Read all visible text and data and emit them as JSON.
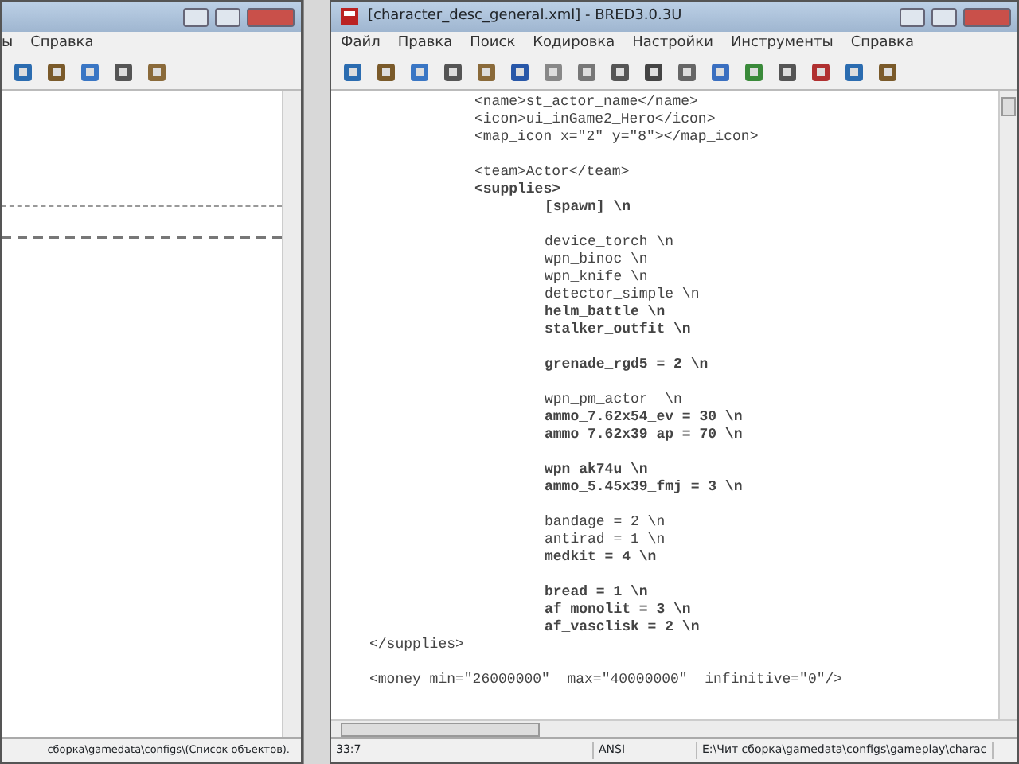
{
  "left_window": {
    "menu": [
      "ы",
      "Справка"
    ],
    "status_bar": "сборка\\gamedata\\configs\\(Список объектов)."
  },
  "editor_window": {
    "title": "[character_desc_general.xml] - BRED3.0.3U",
    "menu": [
      "Файл",
      "Правка",
      "Поиск",
      "Кодировка",
      "Настройки",
      "Инструменты",
      "Справка"
    ],
    "code": [
      {
        "children": [
          {
            "text": "<name>st_actor_name</name>",
            "bold": false
          },
          {
            "text": "<icon>ui_inGame2_Hero</icon>",
            "bold": false
          },
          {
            "text": "<map_icon x=\"2\" y=\"8\"></map_icon>",
            "bold": false
          },
          {
            "kind": "blank"
          },
          {
            "text": "<team>Actor</team>",
            "bold": false
          },
          {
            "text": "<supplies>",
            "bold": true,
            "children": [
              {
                "text": "[spawn] \\n",
                "bold": true
              },
              {
                "kind": "blank"
              },
              {
                "text": "device_torch \\n",
                "bold": false
              },
              {
                "text": "wpn_binoc \\n",
                "bold": false
              },
              {
                "text": "wpn_knife \\n",
                "bold": false
              },
              {
                "text": "detector_simple \\n",
                "bold": false
              },
              {
                "text": "helm_battle \\n",
                "bold": true
              },
              {
                "text": "stalker_outfit \\n",
                "bold": true
              },
              {
                "kind": "blank"
              },
              {
                "text": "grenade_rgd5 = 2 \\n",
                "bold": true
              },
              {
                "kind": "blank"
              },
              {
                "text": "wpn_pm_actor  \\n",
                "bold": false
              },
              {
                "text": "ammo_7.62x54_ev = 30 \\n",
                "bold": true
              },
              {
                "text": "ammo_7.62x39_ap = 70 \\n",
                "bold": true
              },
              {
                "kind": "blank"
              },
              {
                "text": "wpn_ak74u \\n",
                "bold": true
              },
              {
                "text": "ammo_5.45x39_fmj = 3 \\n",
                "bold": true
              },
              {
                "kind": "blank"
              },
              {
                "text": "bandage = 2 \\n",
                "bold": false
              },
              {
                "text": "antirad = 1 \\n",
                "bold": false
              },
              {
                "text": "medkit = 4 \\n",
                "bold": true
              },
              {
                "kind": "blank"
              },
              {
                "text": "bread = 1 \\n",
                "bold": true
              },
              {
                "text": "af_monolit = 3 \\n",
                "bold": true
              },
              {
                "text": "af_vasclisk = 2 \\n",
                "bold": true
              }
            ]
          }
        ]
      },
      {
        "text": "</supplies>",
        "bold": false
      },
      {
        "kind": "blank"
      },
      {
        "text": "<money min=\"26000000\"  max=\"40000000\"  infinitive=\"0\"/>",
        "bold": false
      }
    ],
    "status_bar": [
      {
        "text": "33:7"
      },
      {
        "text": "ANSI"
      },
      {
        "text": "E:\\Чит сборка\\gamedata\\configs\\gameplay\\charac"
      }
    ]
  }
}
